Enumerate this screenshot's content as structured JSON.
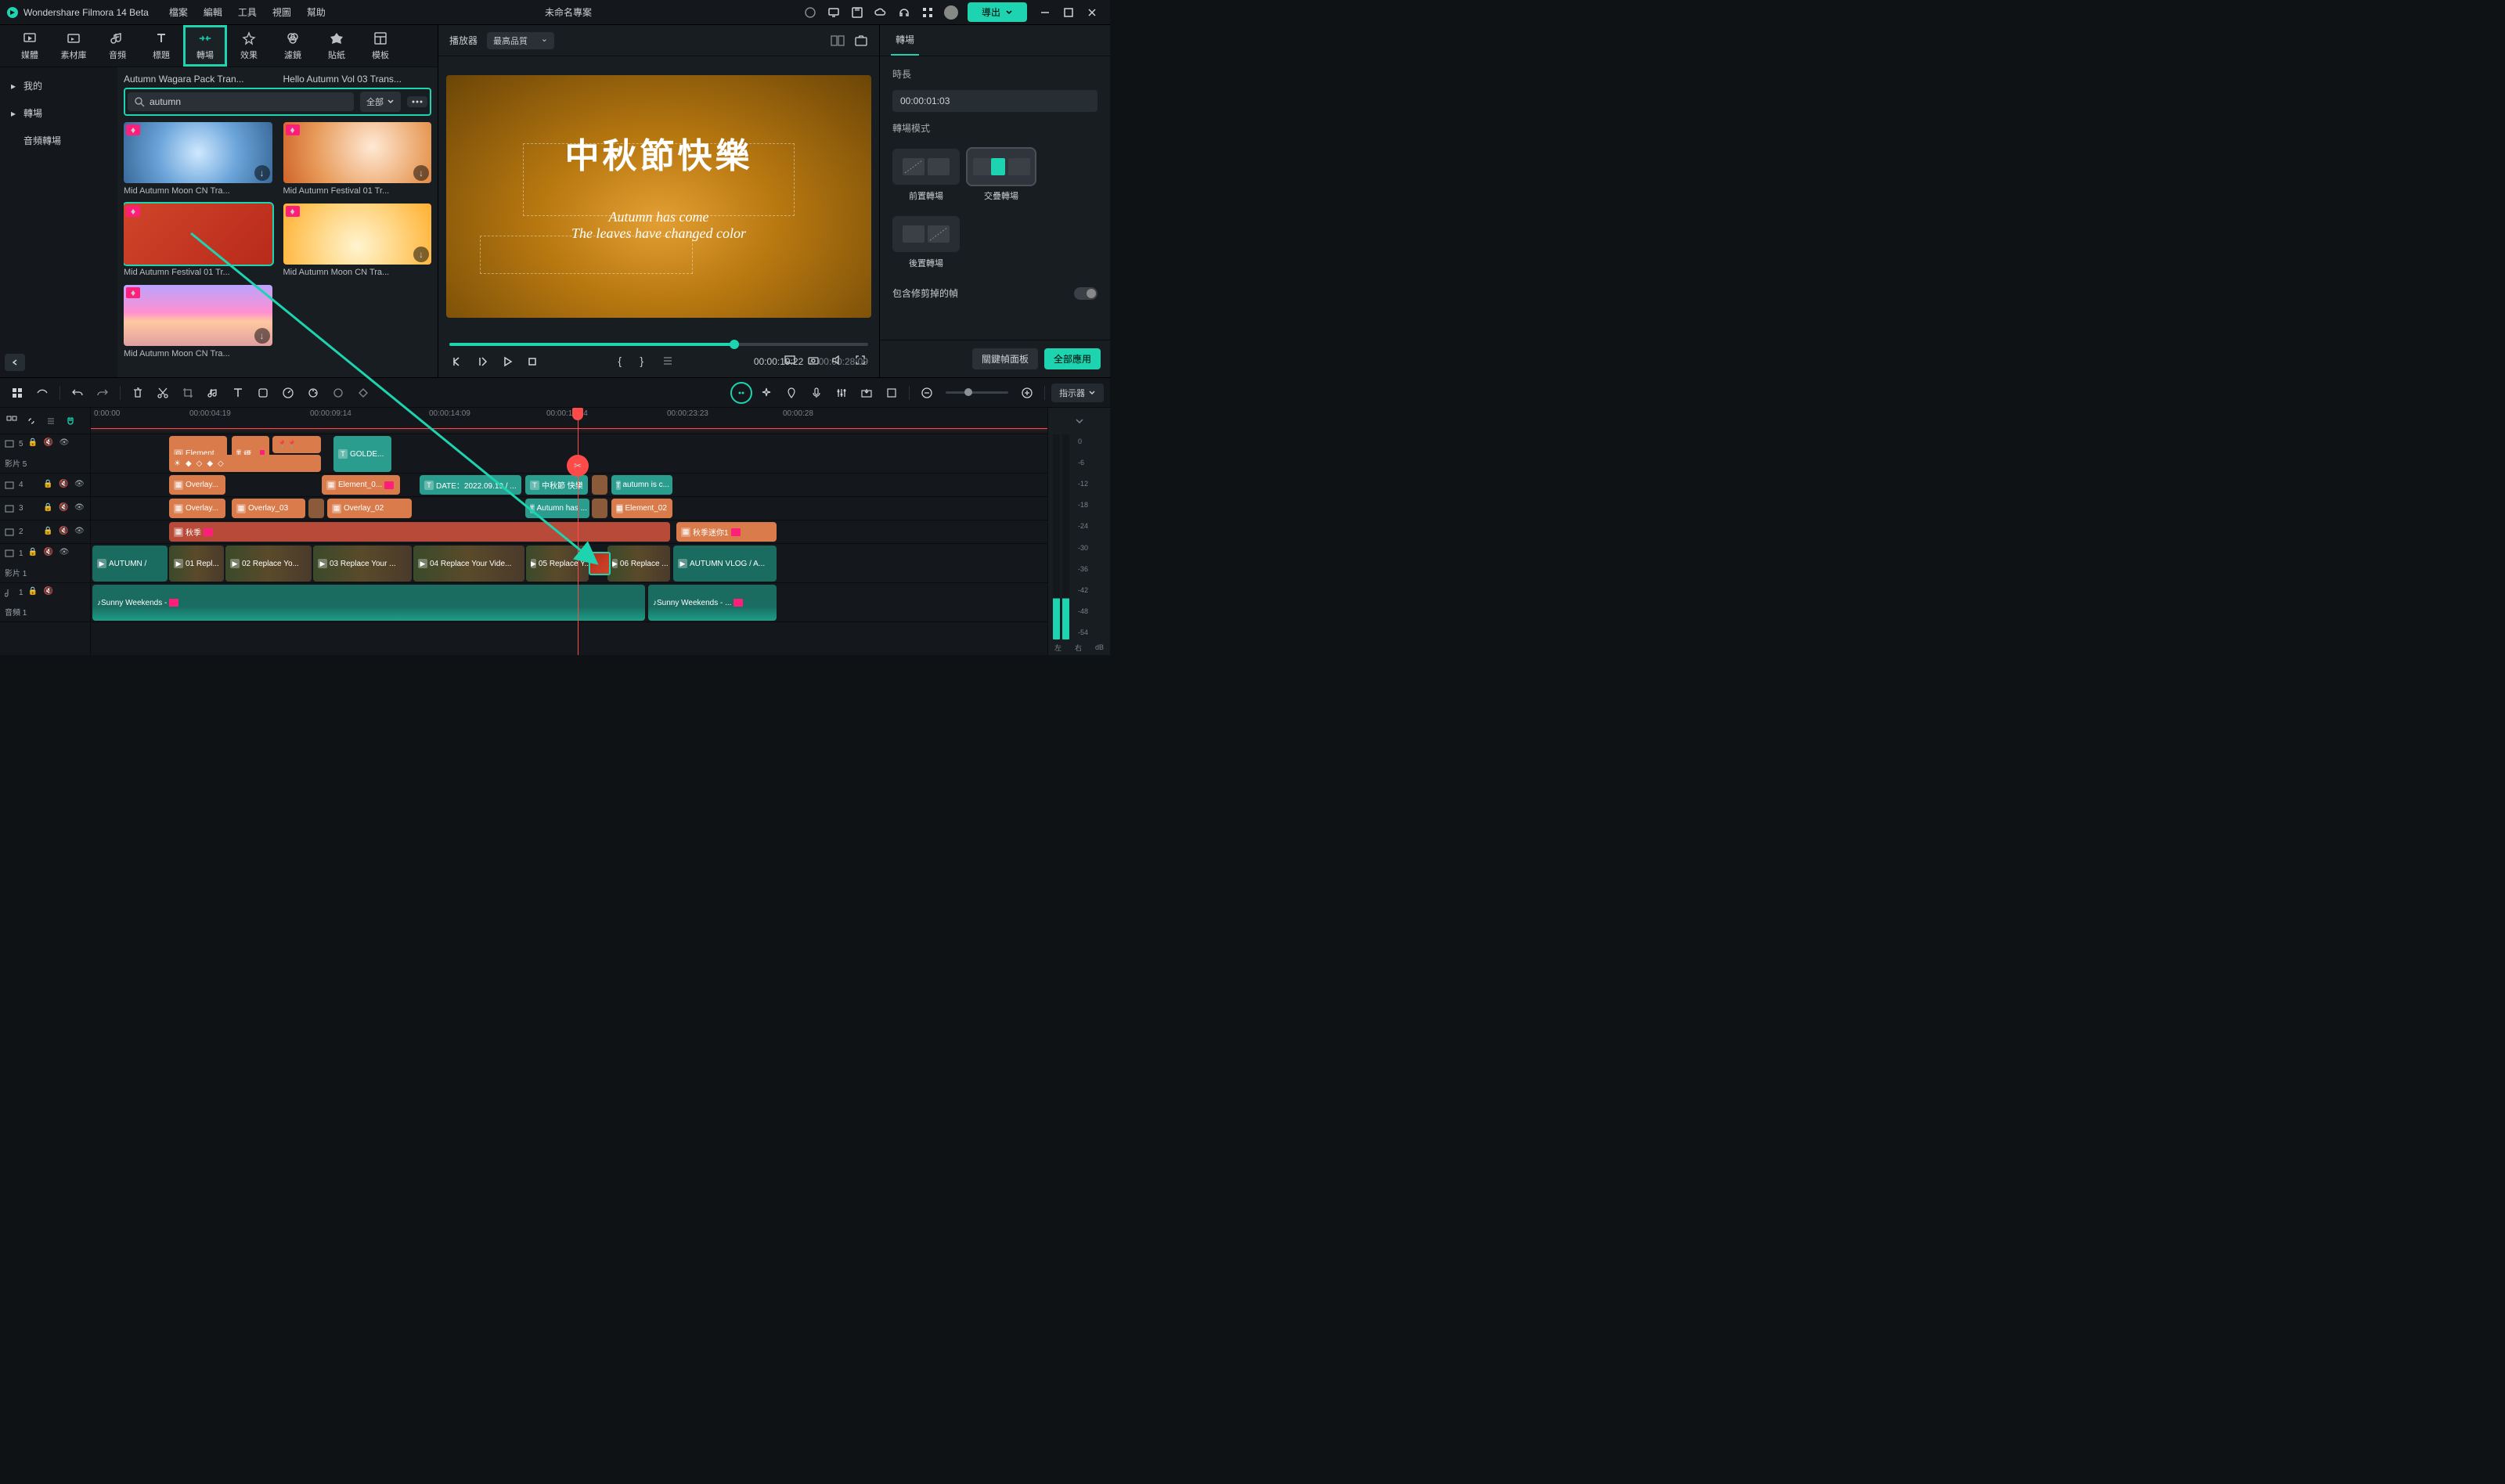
{
  "titlebar": {
    "app": "Wondershare Filmora 14 Beta",
    "menu": [
      "檔案",
      "編輯",
      "工具",
      "視圖",
      "幫助"
    ],
    "project": "未命名專案",
    "export": "導出"
  },
  "modules": [
    "媒體",
    "素材庫",
    "音頻",
    "標題",
    "轉場",
    "效果",
    "濾鏡",
    "貼紙",
    "模板"
  ],
  "sidebar": {
    "items": [
      "我的",
      "轉場",
      "音頻轉場"
    ]
  },
  "search": {
    "value": "autumn",
    "category": "全部"
  },
  "library": [
    {
      "label": "Autumn Wagara Pack Tran..."
    },
    {
      "label": "Hello Autumn Vol 03 Trans..."
    },
    {
      "label": "Mid Autumn Moon CN Tra..."
    },
    {
      "label": "Mid Autumn Festival 01 Tr..."
    },
    {
      "label": "Mid Autumn Festival 01 Tr..."
    },
    {
      "label": "Mid Autumn Moon CN Tra..."
    },
    {
      "label": "Mid Autumn Moon CN Tra..."
    }
  ],
  "preview": {
    "player_label": "播放器",
    "quality": "最高品質",
    "title": "中秋節快樂",
    "sub1": "Autumn has come",
    "sub2": "The leaves have changed color",
    "current": "00:00:19:22",
    "duration": "00:00:28:09"
  },
  "right": {
    "tab": "轉場",
    "duration_label": "時長",
    "duration": "00:00:01:03",
    "mode_label": "轉場模式",
    "modes": [
      "前置轉場",
      "交疊轉場",
      "後置轉場"
    ],
    "toggle_label": "包含修剪掉的幀",
    "footer": [
      "關鍵幀面板",
      "全部應用"
    ]
  },
  "ruler": [
    "0:00:00",
    "00:00:04:19",
    "00:00:09:14",
    "00:00:14:09",
    "00:00:19:04",
    "00:00:23:23",
    "00:00:28"
  ],
  "timeline": {
    "indicator": "指示器",
    "tracks": {
      "t5": {
        "label": "影片 5",
        "num": "5"
      },
      "t4": {
        "num": "4"
      },
      "t3": {
        "num": "3"
      },
      "t2": {
        "num": "2"
      },
      "t1": {
        "label": "影片 1",
        "num": "1"
      },
      "a1": {
        "label": "音頻 1",
        "num": "1"
      }
    },
    "clips": {
      "element1": "Element...",
      "title1": "標...",
      "golden": "GOLDE...",
      "overlay_a": "Overlay...",
      "element0": "Element_0...",
      "date": "DATE：2022.09.19 / ...",
      "mid_autumn": "中秋節 快樂",
      "autumn_is": "autumn is c...",
      "overlay_b": "Overlay...",
      "overlay03": "Overlay_03",
      "overlay02": "Overlay_02",
      "autumn_has": "Autumn has ...",
      "element02": "Element_02",
      "autumn": "秋季",
      "autumn_mini": "秋季迷你1",
      "autumn_vlog": "AUTUMN /",
      "autumn_vlog_end": "AUTUMN VLOG / A...",
      "r1": "01 Repl...",
      "r2": "02 Replace Yo...",
      "r3": "03 Replace Your ...",
      "r4": "04 Replace Your Vide...",
      "r5": "05 Replace Y...",
      "r6": "06 Replace ...",
      "sunny": "Sunny Weekends -",
      "sunny2": "Sunny Weekends - ..."
    }
  },
  "meter": {
    "values": [
      "0",
      "-6",
      "-12",
      "-18",
      "-24",
      "-30",
      "-36",
      "-42",
      "-48",
      "-54"
    ],
    "unit": "dB",
    "left": "左",
    "right": "右"
  }
}
